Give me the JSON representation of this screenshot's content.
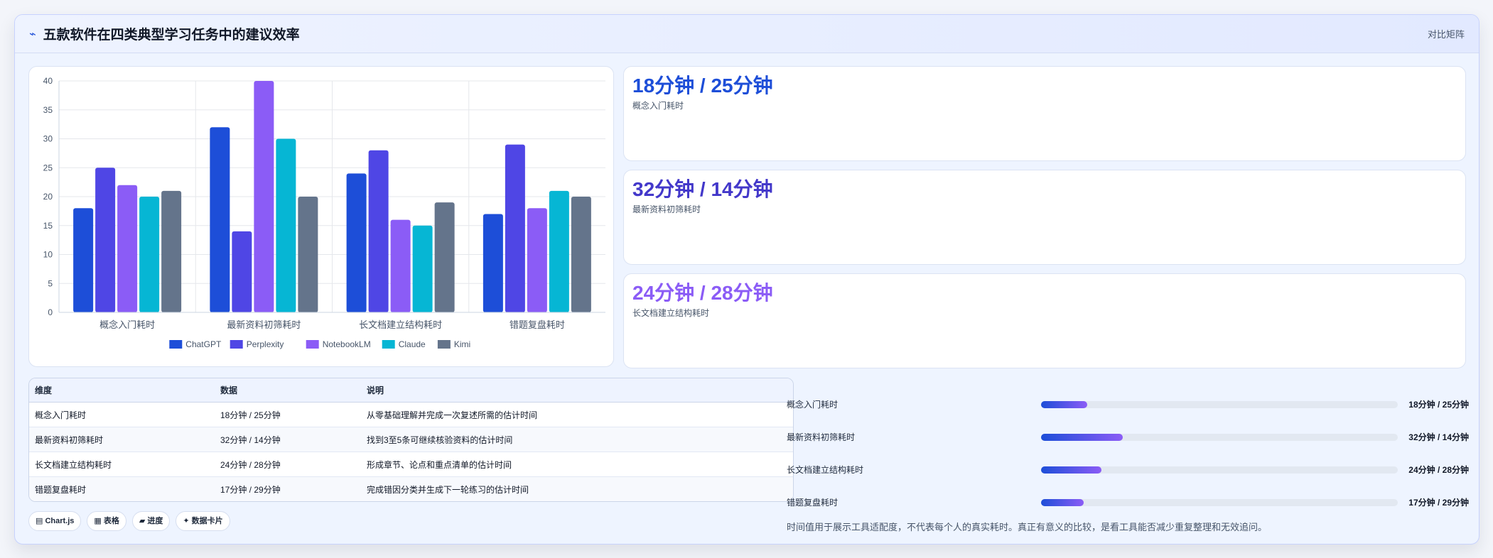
{
  "header": {
    "title": "五款软件在四类典型学习任务中的建议效率",
    "tag": "对比矩阵",
    "icon": "sparkline-icon"
  },
  "chart_data": {
    "type": "bar",
    "categories": [
      "概念入门耗时",
      "最新资料初筛耗时",
      "长文档建立结构耗时",
      "错题复盘耗时"
    ],
    "series": [
      {
        "name": "ChatGPT",
        "color": "#1d4ed8",
        "values": [
          18,
          32,
          24,
          17
        ]
      },
      {
        "name": "Perplexity",
        "color": "#4f46e5",
        "values": [
          25,
          14,
          28,
          29
        ]
      },
      {
        "name": "NotebookLM",
        "color": "#8b5cf6",
        "values": [
          22,
          40,
          16,
          18
        ]
      },
      {
        "name": "Claude",
        "color": "#06b6d4",
        "values": [
          20,
          30,
          15,
          21
        ]
      },
      {
        "name": "Kimi",
        "color": "#64748b",
        "values": [
          21,
          20,
          19,
          20
        ]
      }
    ],
    "ylim": [
      0,
      40
    ],
    "yticks": [
      0,
      5,
      10,
      15,
      20,
      25,
      30,
      35,
      40
    ],
    "grid": true,
    "legend": "bottom"
  },
  "stats": [
    {
      "value": "18分钟 / 25分钟",
      "label": "概念入门耗时",
      "color": "#1d4ed8"
    },
    {
      "value": "32分钟 / 14分钟",
      "label": "最新资料初筛耗时",
      "color": "#4338ca"
    },
    {
      "value": "24分钟 / 28分钟",
      "label": "长文档建立结构耗时",
      "color": "#8b5cf6"
    }
  ],
  "table": {
    "headers": [
      "维度",
      "数据",
      "说明"
    ],
    "rows": [
      [
        "概念入门耗时",
        "18分钟 / 25分钟",
        "从零基础理解并完成一次复述所需的估计时间"
      ],
      [
        "最新资料初筛耗时",
        "32分钟 / 14分钟",
        "找到3至5条可继续核验资料的估计时间"
      ],
      [
        "长文档建立结构耗时",
        "24分钟 / 28分钟",
        "形成章节、论点和重点清单的估计时间"
      ],
      [
        "错题复盘耗时",
        "17分钟 / 29分钟",
        "完成错因分类并生成下一轮练习的估计时间"
      ]
    ]
  },
  "progress": [
    {
      "label": "概念入门耗时",
      "value": "18分钟 / 25分钟",
      "fraction": 0.13
    },
    {
      "label": "最新资料初筛耗时",
      "value": "32分钟 / 14分钟",
      "fraction": 0.23
    },
    {
      "label": "长文档建立结构耗时",
      "value": "24分钟 / 28分钟",
      "fraction": 0.17
    },
    {
      "label": "错题复盘耗时",
      "value": "17分钟 / 29分钟",
      "fraction": 0.12
    }
  ],
  "pills": [
    {
      "icon": "chart-icon",
      "label": "▤ Chart.js"
    },
    {
      "icon": "table-icon",
      "label": "▦ 表格"
    },
    {
      "icon": "progress-icon",
      "label": "▰ 进度"
    },
    {
      "icon": "card-icon",
      "label": "✦ 数据卡片"
    }
  ],
  "footnote": "时间值用于展示工具适配度，不代表每个人的真实耗时。真正有意义的比较，是看工具能否减少重复整理和无效追问。"
}
